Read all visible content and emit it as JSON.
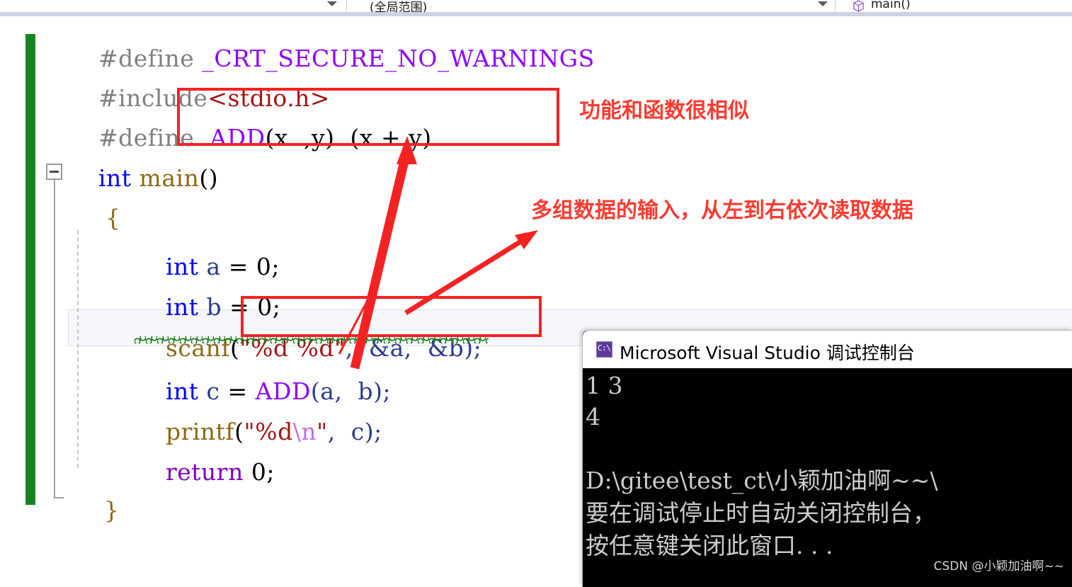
{
  "navbar": {
    "project_scope": "(全局范围)",
    "method": "main()",
    "method_icon": "method-cube-icon",
    "caret_icon": "chevron-down-icon"
  },
  "editor": {
    "lines": [
      {
        "id": "l1",
        "text": "#define _CRT_SECURE_NO_WARNINGS"
      },
      {
        "id": "l2",
        "text": "#include<stdio.h>"
      },
      {
        "id": "l3",
        "text": "#define ADD(x  ,y)  (x + y)"
      },
      {
        "id": "l4",
        "text": "int main()"
      },
      {
        "id": "l5",
        "text": "{"
      },
      {
        "id": "l6",
        "text": "int a = 0;"
      },
      {
        "id": "l7",
        "text": "int b = 0;"
      },
      {
        "id": "l8",
        "text": "scanf(\"%d %d\",  &a,  &b);"
      },
      {
        "id": "l9",
        "text": "int c = ADD(a,  b);"
      },
      {
        "id": "l10",
        "text": "printf(\"%d\\n\",  c);"
      },
      {
        "id": "l11",
        "text": "return 0;"
      },
      {
        "id": "l12",
        "text": "}"
      }
    ],
    "tokens": {
      "define": "#define",
      "crt_macro": "_CRT_SECURE_NO_WARNINGS",
      "include": "#include",
      "header": "<stdio.h>",
      "add_macro": "ADD",
      "add_params": "(x  ,y)  (x + y)",
      "kw_int": "int",
      "fn_main": "main",
      "paren_empty": "()",
      "brace_open": "{",
      "brace_close": "}",
      "var_a": "a",
      "var_b": "b",
      "var_c": "c",
      "assign_zero": " = 0;",
      "fn_scanf": "scanf",
      "scanf_fmt": "\"%d %d\"",
      "scanf_args": ",  &a,  &b);",
      "eq": " = ",
      "add_call_args": "(a,  b);",
      "fn_printf": "printf",
      "printf_open": "(",
      "printf_fmt_a": "\"%d",
      "printf_escape": "\\n",
      "printf_fmt_b": "\"",
      "printf_args": ",  c);",
      "kw_return": "return",
      "return_val": " 0;"
    },
    "collapse_icon": "collapse-minus-icon"
  },
  "annotations": {
    "note_define": "功能和函数很相似",
    "note_scanf": "多组数据的输入，从左到右依次读取数据",
    "box_color": "#f52222",
    "text_color": "#fa3b30",
    "arrow_define_name": "arrow-to-define-box",
    "arrow_scanf_name": "arrow-to-scanf-note"
  },
  "console": {
    "icon": "console-app-icon",
    "icon_glyph": "C:\\",
    "title": "Microsoft Visual Studio 调试控制台",
    "lines": [
      "1 3",
      "4",
      "",
      "D:\\gitee\\test_ct\\小颖加油啊~~\\",
      "要在调试停止时自动关闭控制台，",
      "按任意键关闭此窗口. . ."
    ]
  },
  "watermark": "CSDN @小颖加油啊~~"
}
